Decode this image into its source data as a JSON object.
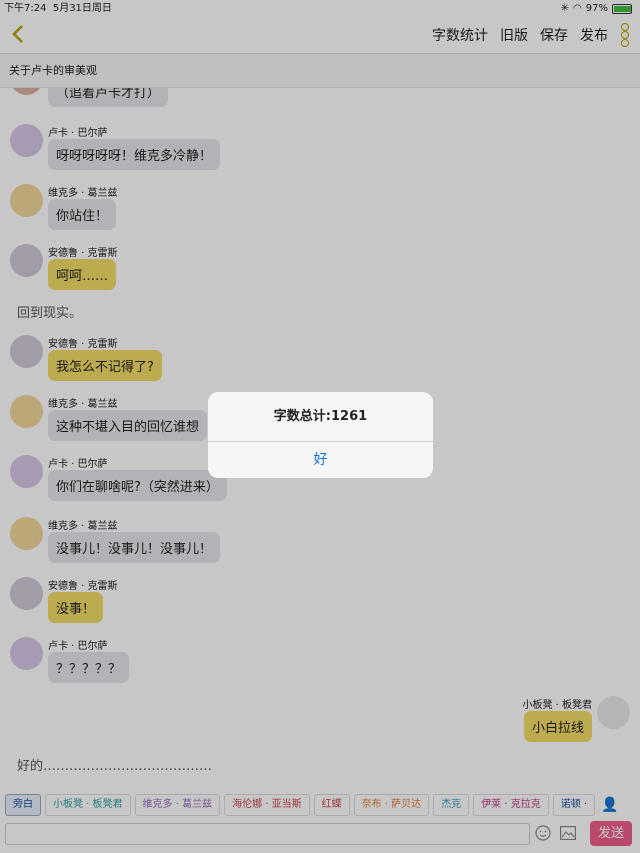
{
  "status": {
    "time": "下午7:24",
    "date": "5月31日周日",
    "battery": "97%",
    "battery_level": 0.97
  },
  "nav": {
    "word_count_label": "字数统计",
    "old_version_label": "旧版",
    "save_label": "保存",
    "publish_label": "发布"
  },
  "title": "关于卢卡的审美观",
  "messages": [
    {
      "type": "bubble",
      "text": "（追着卢卡才打）",
      "style": "grey"
    },
    {
      "type": "char",
      "name": "卢卡 · 巴尔萨",
      "text": "呀呀呀呀呀！维克多冷静！",
      "style": "grey"
    },
    {
      "type": "char",
      "name": "维克多 · 葛兰兹",
      "text": "你站住！",
      "style": "grey"
    },
    {
      "type": "char",
      "name": "安德鲁 · 克雷斯",
      "text": "呵呵……",
      "style": "gold"
    },
    {
      "type": "narration",
      "text": "回到现实。"
    },
    {
      "type": "char",
      "name": "安德鲁 · 克雷斯",
      "text": "我怎么不记得了?",
      "style": "gold"
    },
    {
      "type": "char",
      "name": "维克多 · 葛兰兹",
      "text": "这种不堪入目的回忆谁想",
      "style": "grey"
    },
    {
      "type": "char",
      "name": "卢卡 · 巴尔萨",
      "text": "你们在聊啥呢?（突然进来）",
      "style": "grey"
    },
    {
      "type": "char",
      "name": "维克多 · 葛兰兹",
      "text": "没事儿！没事儿！没事儿！",
      "style": "grey"
    },
    {
      "type": "char",
      "name": "安德鲁 · 克雷斯",
      "text": "没事！",
      "style": "gold"
    },
    {
      "type": "char",
      "name": "卢卡 · 巴尔萨",
      "text": "？？？？？",
      "style": "grey"
    },
    {
      "type": "self",
      "name": "小板凳 · 板凳君",
      "text": "小白拉线",
      "style": "gold"
    },
    {
      "type": "narration",
      "text": "好的…………………………………"
    }
  ],
  "dialog": {
    "title": "字数总计:1261",
    "ok_label": "好"
  },
  "characters": [
    {
      "label": "旁白",
      "color": "#1a4fa0",
      "active": true
    },
    {
      "label": "小板凳 · 板凳君",
      "color": "#2f9fa8",
      "active": false
    },
    {
      "label": "维克多 · 葛兰兹",
      "color": "#9a6fc0",
      "active": false
    },
    {
      "label": "海伦娜 · 亚当斯",
      "color": "#d0454a",
      "active": false
    },
    {
      "label": "红蝶",
      "color": "#d0454a",
      "active": false
    },
    {
      "label": "奈布 · 萨贝达",
      "color": "#e0813a",
      "active": false
    },
    {
      "label": "杰克",
      "color": "#3a9ad0",
      "active": false
    },
    {
      "label": "伊莱 · 克拉克",
      "color": "#c03a8a",
      "active": false
    },
    {
      "label": "诺顿 ·",
      "color": "#1a4fa0",
      "active": false
    }
  ],
  "input": {
    "send_label": "发送"
  }
}
